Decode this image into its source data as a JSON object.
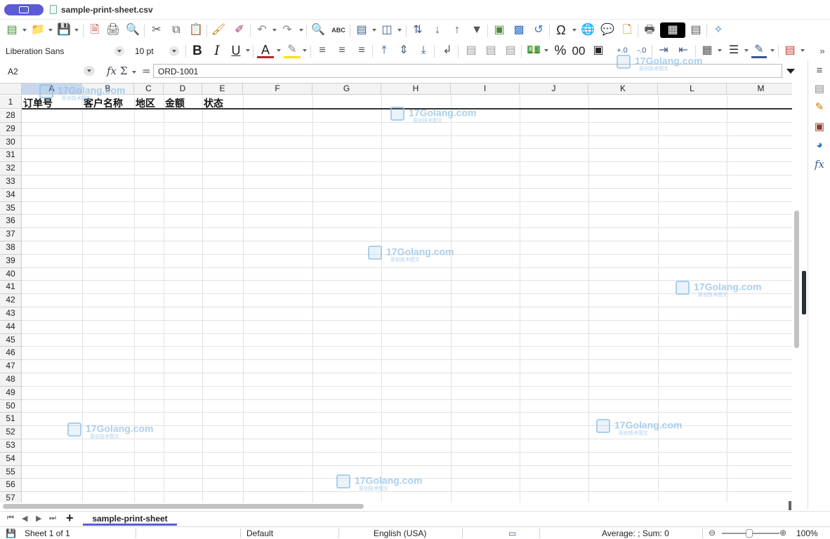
{
  "window": {
    "doc_title": "sample-print-sheet.csv"
  },
  "format": {
    "font_name": "Liberation Sans",
    "font_size": "10 pt"
  },
  "formula": {
    "cell_ref": "A2",
    "content": "ORD-1001",
    "fx": "fx",
    "sigma": "Σ",
    "equals": "="
  },
  "columns": [
    "A",
    "B",
    "C",
    "D",
    "E",
    "F",
    "G",
    "H",
    "I",
    "J",
    "K",
    "L",
    "M"
  ],
  "header_row": {
    "number": "1",
    "cells": [
      "订单号",
      "客户名称",
      "地区",
      "金额",
      "状态"
    ]
  },
  "rows": [
    "28",
    "29",
    "30",
    "31",
    "32",
    "33",
    "34",
    "35",
    "36",
    "37",
    "38",
    "39",
    "40",
    "41",
    "42",
    "43",
    "44",
    "45",
    "46",
    "47",
    "48",
    "49",
    "50",
    "51",
    "52",
    "53",
    "54",
    "55",
    "56",
    "57"
  ],
  "sheet_tabs": {
    "active": "sample-print-sheet",
    "add": "+"
  },
  "status": {
    "sheet_info": "Sheet 1 of 1",
    "page_style": "Default",
    "language": "English (USA)",
    "summary": "Average: ; Sum: 0",
    "zoom": "100%"
  },
  "watermark": {
    "text": "17Golang.com",
    "sub": "原创技术图文"
  },
  "toolbar": {
    "spell_label": "ABC",
    "percent": "%",
    "decimal": "00"
  },
  "colors": {
    "accent": "#5b5bd6",
    "header_bg": "#f3f3f3",
    "selected_header": "#c8d7ec"
  }
}
